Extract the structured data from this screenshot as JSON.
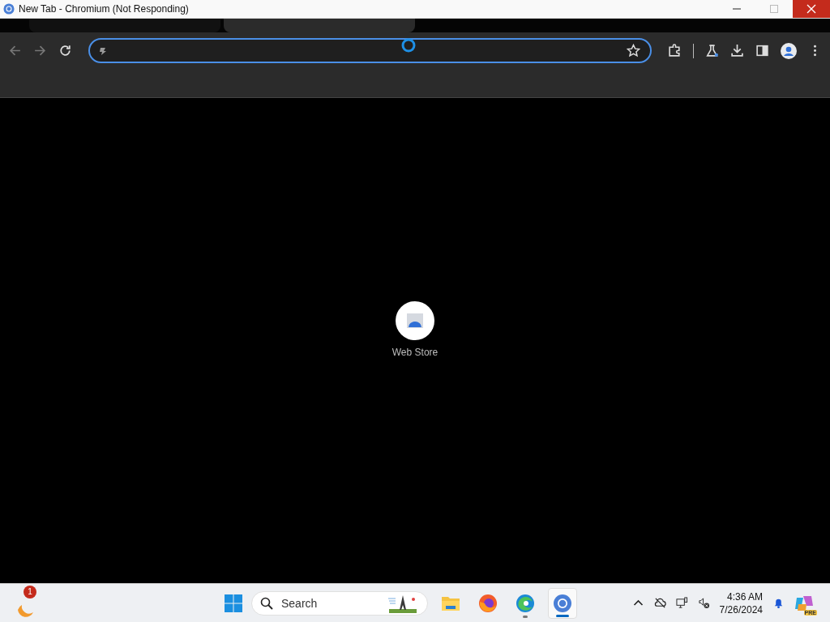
{
  "window": {
    "title": "New Tab - Chromium (Not Responding)"
  },
  "tabs": [
    {
      "selected": false
    },
    {
      "selected": true
    }
  ],
  "shortcuts": [
    {
      "label": "Web Store"
    }
  ],
  "taskbar": {
    "widget_badge": "1",
    "search": {
      "placeholder": "Search"
    },
    "apps": [
      {
        "kind": "explorer",
        "running": false,
        "selected": false
      },
      {
        "kind": "firefox",
        "running": false,
        "selected": false
      },
      {
        "kind": "edge",
        "running": true,
        "selected": false
      },
      {
        "kind": "chromium",
        "running": true,
        "selected": true
      }
    ],
    "time": "4:36 AM",
    "date": "7/26/2024",
    "copilot_badge": "PRE"
  }
}
